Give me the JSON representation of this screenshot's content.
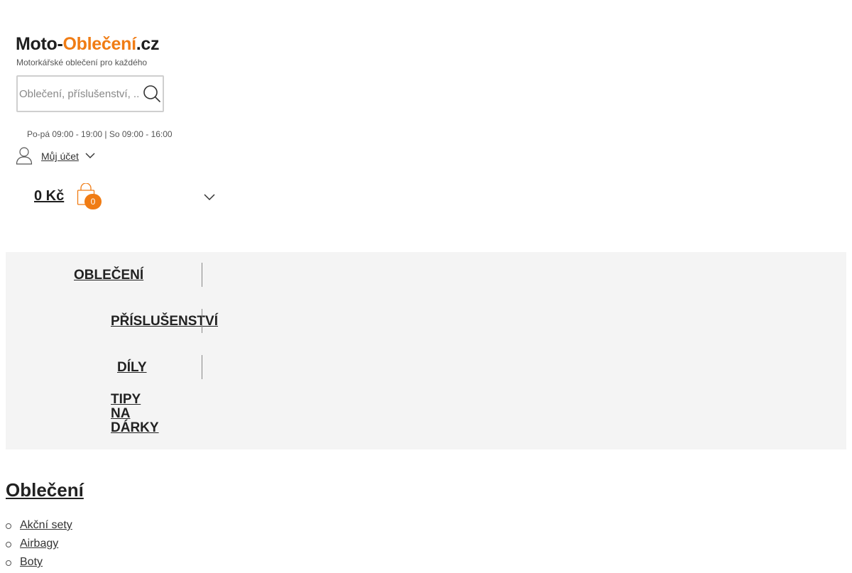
{
  "header": {
    "logo": {
      "dark": "Moto-",
      "accent": "Oblečení",
      "suffix": ".cz",
      "tagline": "Motorkářské oblečení pro každého"
    },
    "search": {
      "placeholder": "Oblečení, příslušenství, ..."
    },
    "hours": "Po-pá 09:00 - 19:00 | So 09:00 - 16:00",
    "account": {
      "label": "Můj účet"
    },
    "cart": {
      "price": "0 Kč",
      "count": "0"
    }
  },
  "nav": {
    "items": [
      {
        "label": "OBLEČENÍ"
      },
      {
        "label": "PŘÍSLUŠENSTVÍ"
      },
      {
        "label": "DÍLY"
      },
      {
        "label": "TIPY NA DÁRKY",
        "lines": [
          "TIPY",
          "NA",
          "DÁRKY"
        ]
      }
    ]
  },
  "category": {
    "title": "Oblečení",
    "items": [
      {
        "label": "Akční sety"
      },
      {
        "label": "Airbagy"
      },
      {
        "label": "Boty"
      }
    ]
  },
  "colors": {
    "accent": "#f07c14",
    "nav_bg": "#f4f4f4",
    "text": "#333333"
  }
}
